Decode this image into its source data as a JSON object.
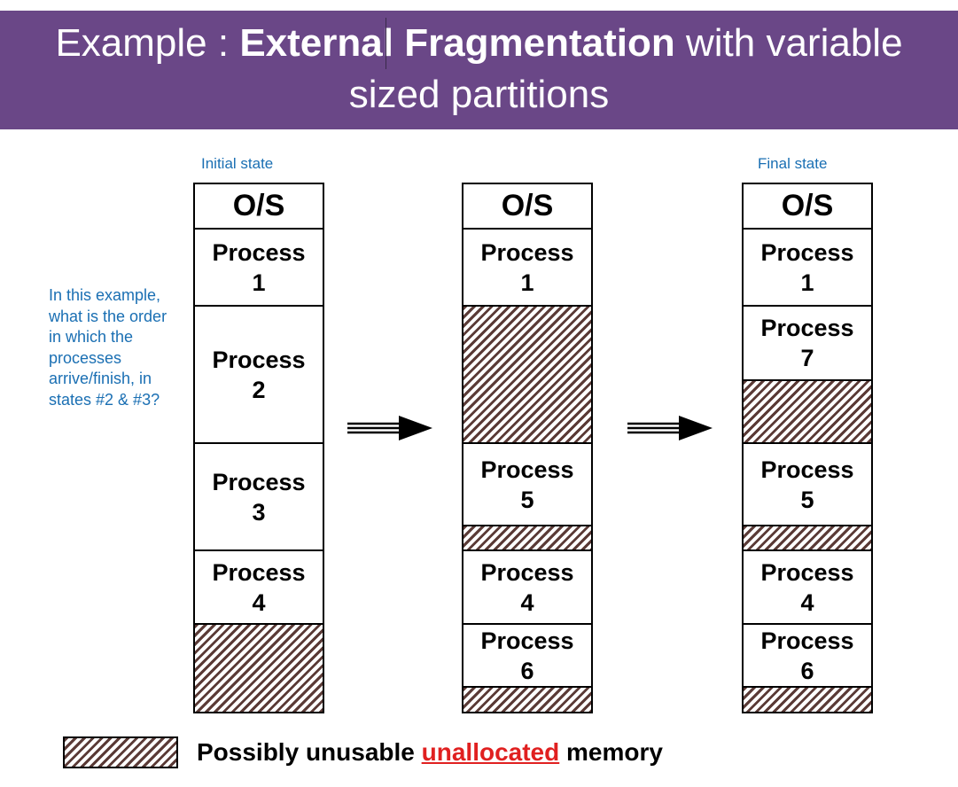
{
  "title": {
    "prefix": "Example : ",
    "bold1": "External",
    "bold2": "Fragmentation",
    "suffix": " with variable",
    "line2": "sized partitions"
  },
  "labels": {
    "initial": "Initial state",
    "final": "Final state"
  },
  "question": "In this example, what is the order in which the processes arrive/finish, in states #2 & #3?",
  "columns": [
    {
      "segments": [
        {
          "type": "os",
          "label": "O/S"
        },
        {
          "type": "process",
          "label": "Process\n1"
        },
        {
          "type": "process",
          "label": "Process\n2"
        },
        {
          "type": "process",
          "label": "Process\n3"
        },
        {
          "type": "process",
          "label": "Process\n4"
        },
        {
          "type": "free"
        }
      ]
    },
    {
      "segments": [
        {
          "type": "os",
          "label": "O/S"
        },
        {
          "type": "process",
          "label": "Process\n1"
        },
        {
          "type": "free"
        },
        {
          "type": "process",
          "label": "Process\n5"
        },
        {
          "type": "free"
        },
        {
          "type": "process",
          "label": "Process\n4"
        },
        {
          "type": "process",
          "label": "Process\n6"
        },
        {
          "type": "free"
        }
      ]
    },
    {
      "segments": [
        {
          "type": "os",
          "label": "O/S"
        },
        {
          "type": "process",
          "label": "Process\n1"
        },
        {
          "type": "process",
          "label": "Process\n7"
        },
        {
          "type": "free"
        },
        {
          "type": "process",
          "label": "Process\n5"
        },
        {
          "type": "free"
        },
        {
          "type": "process",
          "label": "Process\n4"
        },
        {
          "type": "process",
          "label": "Process\n6"
        },
        {
          "type": "free"
        }
      ]
    }
  ],
  "legend": {
    "before": "Possibly unusable ",
    "highlight": "unallocated",
    "after": " memory"
  },
  "colors": {
    "banner": "#6a4787",
    "label_blue": "#1a6fb3",
    "hatch": "#5a3a36",
    "highlight_red": "#e02020"
  }
}
